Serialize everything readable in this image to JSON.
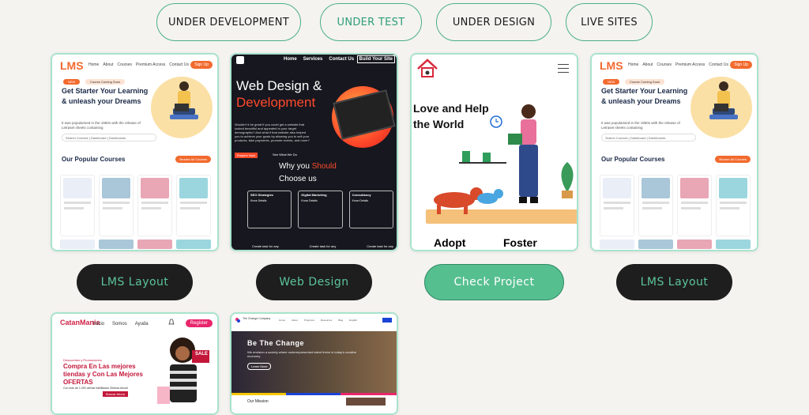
{
  "tabs": [
    {
      "label": "UNDER DEVELOPMENT",
      "active": false
    },
    {
      "label": "UNDER TEST",
      "active": true
    },
    {
      "label": "UNDER DESIGN",
      "active": false
    },
    {
      "label": "LIVE SITES",
      "active": false
    }
  ],
  "projects": [
    {
      "button": "LMS Layout",
      "style": "dark"
    },
    {
      "button": "Web Design",
      "style": "dark"
    },
    {
      "button": "Check Project",
      "style": "green"
    },
    {
      "button": "LMS Layout",
      "style": "dark"
    }
  ],
  "lms": {
    "logo": "LMS",
    "nav": [
      "Home",
      "About",
      "Courses",
      "Premium Access",
      "Contact Us"
    ],
    "signup": "Sign Up",
    "badge_new": "NEW",
    "badge_text": "Course Coming Soon",
    "heading": "Get Starter Your Learning & unleash your Dreams",
    "sub": "It was popularised in the 1960s with the release of Letraset sheets containing",
    "search": "Search Courses  |  Dashboard  |  Dashboards",
    "popular": "Our Popular Courses",
    "popular_btn": "Browse All Courses"
  },
  "webdesign": {
    "nav": [
      "Home",
      "Services",
      "Contact Us"
    ],
    "cta_top": "Build Your Site",
    "title_1": "Web Design &",
    "title_2": "Development",
    "para": "Wouldn't it be great if you could get a website that looked beautiful and appealed to your target demographic? And what if that website also helped you to achieve your goals by allowing you to sell your products, take payments, promote events, and more?",
    "cta": "Enquire Now",
    "what": "See What We Do",
    "why_a": "Why you ",
    "why_b": "Should",
    "choose": "Choose us",
    "boxes": [
      {
        "title": "SEO Strategies",
        "cta": "Know Details"
      },
      {
        "title": "Digital Marketing",
        "cta": "Know Details"
      },
      {
        "title": "Consultancy",
        "cta": "Know Details"
      }
    ],
    "foot": [
      "Create task for any",
      "Create task for any",
      "Create task for any"
    ]
  },
  "adopt": {
    "heading": "Love and Help the World",
    "adopt": "Adopt",
    "foster": "Foster"
  },
  "catan": {
    "logo_top": "CatanMania",
    "nav": [
      "Inicio",
      "Somos",
      "Ayuda"
    ],
    "register": "Register",
    "sale": "SALE",
    "kicker": "Descuentos y Promociones",
    "heading": "Compra En Las mejores tiendas y Con Las Mejores OFERTAS",
    "small": "Con más de 1,000 ofertas habilitadas Disfruta Ahora!",
    "buy": "Buscar Ahora"
  },
  "change": {
    "logo": "The Change Company",
    "nav": [
      "Home",
      "About",
      "Programs",
      "Resources",
      "Blog",
      "English"
    ],
    "hero_title": "Be The Change",
    "hero_sub": "We envision a society where underrepresented talent thrive in today's creative economy.",
    "hero_btn": "Learn More",
    "mission": "Our Mission"
  }
}
